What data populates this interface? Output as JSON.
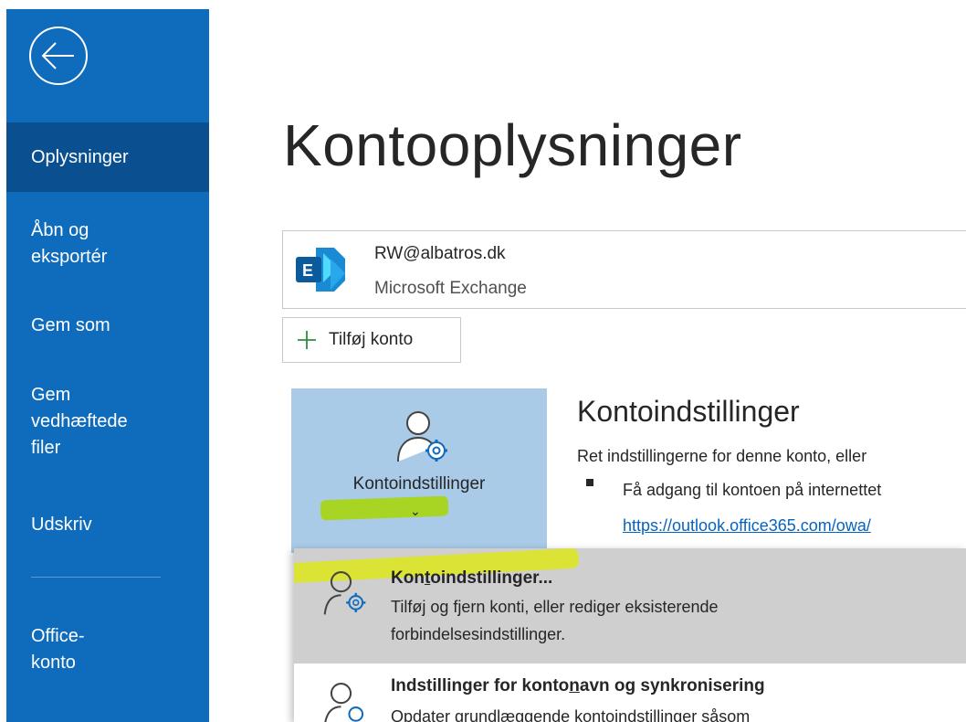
{
  "sidebar": {
    "items": [
      {
        "label": "Oplysninger",
        "active": true
      },
      {
        "label": "Åbn og\neksportér"
      },
      {
        "label": "Gem som"
      },
      {
        "label": "Gem\nvedhæftede\nfiler"
      },
      {
        "label": "Udskriv"
      },
      {
        "label": "Office-\nkonto"
      }
    ],
    "back_icon": "back-arrow-icon",
    "color": "#0f6cbd"
  },
  "main": {
    "title": "Kontooplysninger",
    "account": {
      "email": "RW@albatros.dk",
      "type": "Microsoft Exchange",
      "icon": "exchange-logo-icon"
    },
    "add_account_label": "Tilføj konto",
    "account_settings_button": {
      "label": "Kontoindstillinger",
      "chevron": "⌄"
    },
    "section": {
      "title": "Kontoindstillinger",
      "description": "Ret indstillingerne for denne konto, eller",
      "bullet": "Få adgang til kontoen på internettet",
      "link": "https://outlook.office365.com/owa/"
    }
  },
  "dropdown": {
    "items": [
      {
        "title_pre": "Kon",
        "title_ul": "t",
        "title_post": "oindstillinger...",
        "desc_line1": "Tilføj og fjern konti, eller rediger eksisterende",
        "desc_line2": "forbindelsesindstillinger."
      },
      {
        "title_pre": "Indstillinger for konto",
        "title_ul": "n",
        "title_post": "avn og synkronisering",
        "desc_line1": "Opdater grundlæggende kontoindstillinger såsom"
      }
    ]
  }
}
